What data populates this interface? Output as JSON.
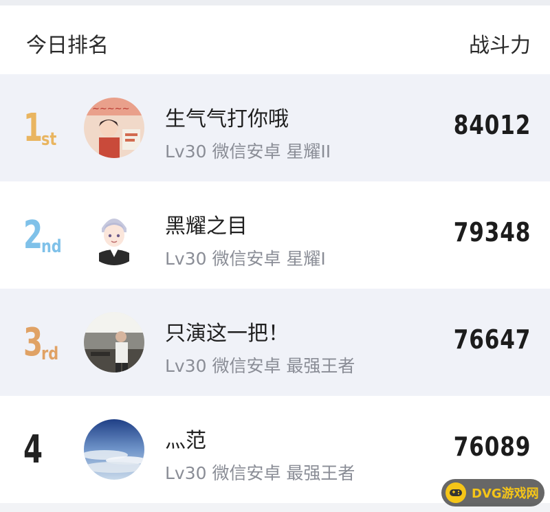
{
  "header": {
    "left_label": "今日排名",
    "right_label": "战斗力"
  },
  "rows": [
    {
      "rank_num": "1",
      "rank_suffix": "st",
      "rank_color": "#e9b560",
      "name": "生气气打你哦",
      "meta": "Lv30 微信安卓 星耀II",
      "power": "84012",
      "avatar": "sticker-photo-avatar"
    },
    {
      "rank_num": "2",
      "rank_suffix": "nd",
      "rank_color": "#7fc1e9",
      "name": "黑耀之目",
      "meta": "Lv30 微信安卓 星耀I",
      "power": "79348",
      "avatar": "cartoon-boy-avatar"
    },
    {
      "rank_num": "3",
      "rank_suffix": "rd",
      "rank_color": "#e0a265",
      "name": "只演这一把！",
      "meta": "Lv30 微信安卓 最强王者",
      "power": "76647",
      "avatar": "person-photo-avatar"
    },
    {
      "rank_num": "4",
      "rank_suffix": "",
      "rank_color": "#222222",
      "name": "灬范",
      "meta": "Lv30 微信安卓 最强王者",
      "power": "76089",
      "avatar": "sky-photo-avatar"
    }
  ],
  "watermark": {
    "text": "DVG游戏网"
  }
}
